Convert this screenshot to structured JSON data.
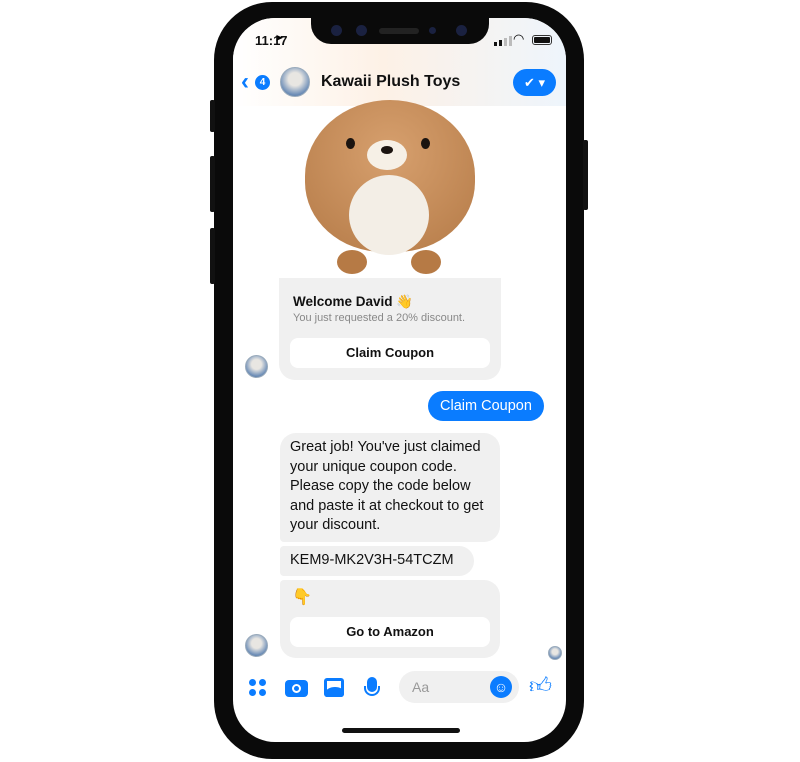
{
  "status": {
    "time": "11:17"
  },
  "header": {
    "back_count": "4",
    "title": "Kawaii Plush Toys"
  },
  "messages": {
    "card1": {
      "title": "Welcome David 👋",
      "subtitle": "You just requested a 20% discount.",
      "button": "Claim Coupon"
    },
    "sent": "Claim Coupon",
    "reply": "Great job! You've just claimed your unique coupon code. Please copy the code below and paste it at checkout to get your discount.",
    "code": "KEM9-MK2V3H-54TCZM",
    "card2": {
      "emoji": "👇",
      "button": "Go to Amazon"
    }
  },
  "composer": {
    "placeholder": "Aa"
  },
  "colors": {
    "accent": "#0a7cff",
    "bubble": "#f0f0f0"
  }
}
